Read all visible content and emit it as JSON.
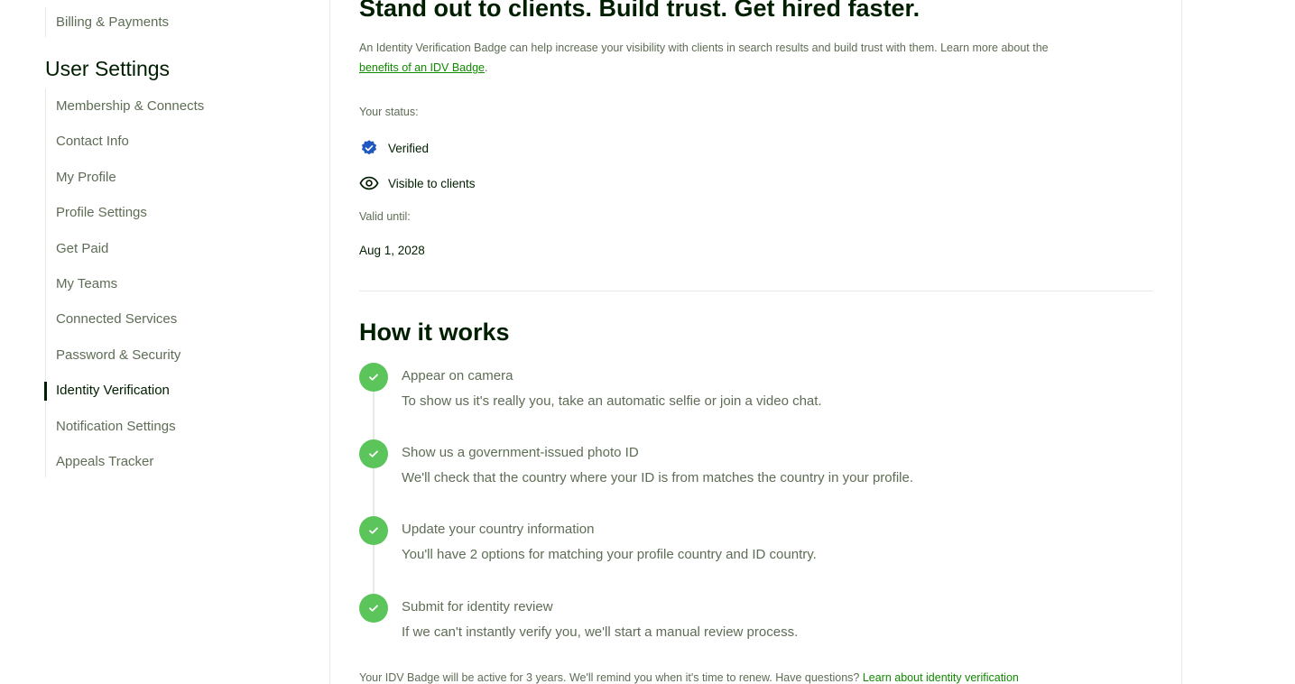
{
  "sidebar": {
    "top_items": [
      {
        "label": "Billing & Payments"
      }
    ],
    "section_title": "User Settings",
    "items": [
      {
        "label": "Membership & Connects"
      },
      {
        "label": "Contact Info"
      },
      {
        "label": "My Profile"
      },
      {
        "label": "Profile Settings"
      },
      {
        "label": "Get Paid"
      },
      {
        "label": "My Teams"
      },
      {
        "label": "Connected Services"
      },
      {
        "label": "Password & Security"
      },
      {
        "label": "Identity Verification",
        "active": true
      },
      {
        "label": "Notification Settings"
      },
      {
        "label": "Appeals Tracker"
      }
    ]
  },
  "main": {
    "headline": "Stand out to clients. Build trust. Get hired faster.",
    "intro_text": "An Identity Verification Badge can help increase your visibility with clients in search results and build trust with them. Learn more about the ",
    "intro_link": "benefits of an IDV Badge",
    "intro_end": ".",
    "status_label": "Your status:",
    "status_verified": "Verified",
    "status_visible": "Visible to clients",
    "valid_label": "Valid until:",
    "valid_date": "Aug 1, 2028",
    "how_title": "How it works",
    "steps": [
      {
        "title": "Appear on camera",
        "desc": "To show us it's really you, take an automatic selfie or join a video chat."
      },
      {
        "title": "Show us a government-issued photo ID",
        "desc": "We'll check that the country where your ID is from matches the country in your profile."
      },
      {
        "title": "Update your country information",
        "desc": "You'll have 2 options for matching your profile country and ID country."
      },
      {
        "title": "Submit for identity review",
        "desc": "If we can't instantly verify you, we'll start a manual review process."
      }
    ],
    "footer_text": "Your IDV Badge will be active for 3 years. We'll remind you when it's time to renew. Have questions? ",
    "footer_link": "Learn about identity verification"
  },
  "colors": {
    "accent_green": "#108a00",
    "check_green": "#5bc45b",
    "verified_blue": "#1f57c3",
    "text_primary": "#001e00",
    "text_secondary": "#5e6d55"
  },
  "icons": {
    "verified": "verified-badge-icon",
    "visible": "eye-icon",
    "step": "check-circle-icon"
  }
}
